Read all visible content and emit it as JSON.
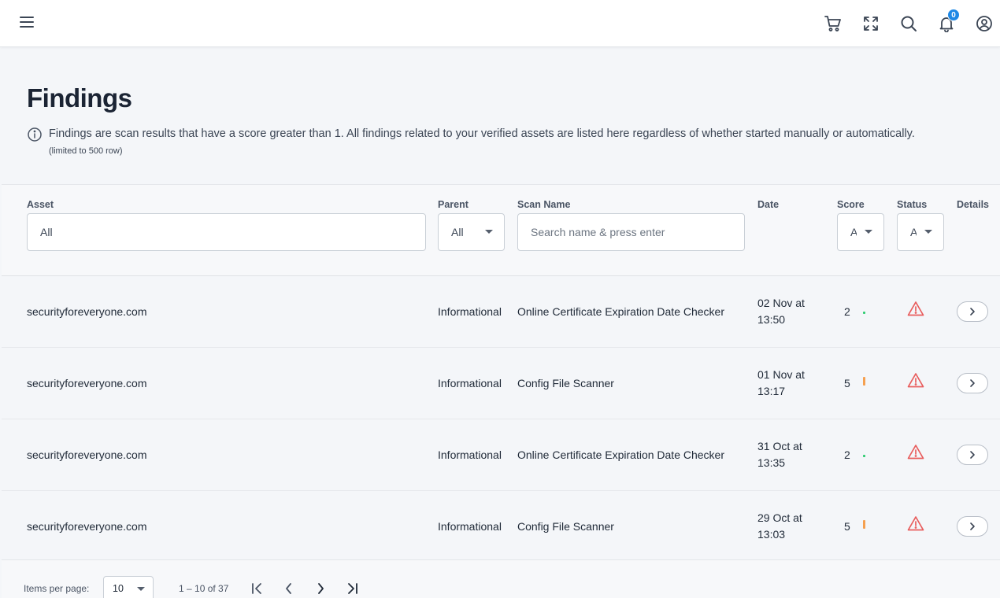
{
  "header": {
    "icons": [
      "menu-icon",
      "cart-icon",
      "fullscreen-icon",
      "search-icon",
      "bell-icon",
      "account-icon"
    ],
    "notification_count": "0"
  },
  "page": {
    "title": "Findings",
    "info_text": "Findings are scan results that have a score greater than 1. All findings related to your verified assets are listed here regardless of whether started manually or automatically.",
    "info_sub": "(limited to 500 row)"
  },
  "filters": {
    "asset_label": "Asset",
    "asset_value": "All",
    "parent_label": "Parent",
    "parent_value": "All",
    "scan_label": "Scan Name",
    "scan_placeholder": "Search name & press enter",
    "date_label": "Date",
    "score_label": "Score",
    "score_value": "All",
    "status_label": "Status",
    "status_value": "All",
    "details_label": "Details"
  },
  "rows": [
    {
      "asset": "securityforeveryone.com",
      "parent": "Informational",
      "scan": "Online Certificate Expiration Date Checker",
      "date_line1": "02 Nov at",
      "date_line2": "13:50",
      "score": "2",
      "score_color": "#2ecc71"
    },
    {
      "asset": "securityforeveryone.com",
      "parent": "Informational",
      "scan": "Config File Scanner",
      "date_line1": "01 Nov at",
      "date_line2": "13:17",
      "score": "5",
      "score_color": "#f5a050"
    },
    {
      "asset": "securityforeveryone.com",
      "parent": "Informational",
      "scan": "Online Certificate Expiration Date Checker",
      "date_line1": "31 Oct at",
      "date_line2": "13:35",
      "score": "2",
      "score_color": "#2ecc71"
    },
    {
      "asset": "securityforeveryone.com",
      "parent": "Informational",
      "scan": "Config File Scanner",
      "date_line1": "29 Oct at",
      "date_line2": "13:03",
      "score": "5",
      "score_color": "#f5a050"
    }
  ],
  "paginator": {
    "items_per_page_label": "Items per page:",
    "items_per_page_value": "10",
    "range": "1 – 10 of 37"
  },
  "colors": {
    "warning": "#e85d5d",
    "badge": "#1e88e5"
  }
}
